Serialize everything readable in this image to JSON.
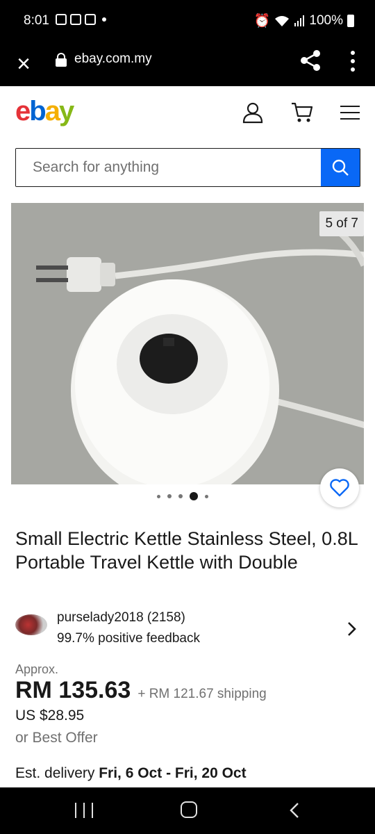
{
  "status_bar": {
    "time": "8:01",
    "battery": "100%"
  },
  "browser": {
    "url": "ebay.com.my"
  },
  "header": {
    "logo": {
      "e": "e",
      "b": "b",
      "a": "a",
      "y": "y"
    },
    "brand_colors": {
      "red": "#e53238",
      "blue": "#0064d2",
      "yellow": "#f5af02",
      "green": "#86b817"
    }
  },
  "search": {
    "placeholder": "Search for anything",
    "button_color": "#0968f6"
  },
  "gallery": {
    "counter": "5 of 7",
    "total_images": 7,
    "current_image": 5
  },
  "listing": {
    "title": "Small Electric Kettle Stainless Steel, 0.8L Portable Travel Kettle with Double"
  },
  "seller": {
    "name": "purselady2018 (2158)",
    "feedback": "99.7% positive feedback"
  },
  "price": {
    "approx_label": "Approx.",
    "amount": "RM 135.63",
    "shipping": "+ RM 121.67 shipping",
    "usd": "US $28.95",
    "best_offer": "or Best Offer"
  },
  "delivery": {
    "label": "Est. delivery ",
    "dates": "Fri, 6 Oct - Fri, 20 Oct"
  }
}
